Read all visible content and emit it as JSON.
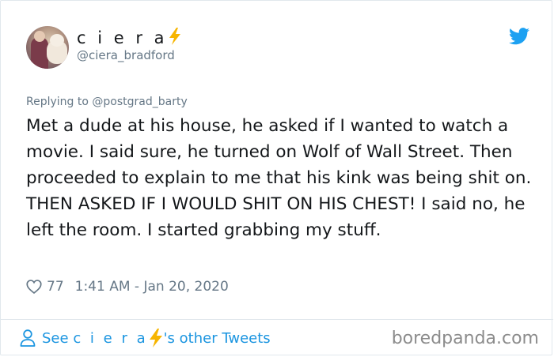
{
  "author": {
    "display_name": "c i e r a",
    "handle": "@ciera_bradford"
  },
  "reply": {
    "prefix": "Replying to",
    "handle": "@postgrad_barty"
  },
  "tweet": {
    "text": "Met a dude at his house, he asked if I wanted to watch a movie. I said sure, he turned on Wolf of Wall Street. Then proceeded to explain to me that his kink was being shit on. THEN ASKED IF I WOULD SHIT ON HIS CHEST! I said no, he left the room. I started grabbing my stuff.",
    "likes": "77",
    "timestamp": "1:41 AM - Jan 20, 2020"
  },
  "footer": {
    "see_prefix": "See",
    "see_name": "c i e r a",
    "see_suffix": "'s other Tweets",
    "watermark": "boredpanda.com"
  },
  "colors": {
    "link": "#1b95e0",
    "muted": "#657786",
    "text": "#14171a",
    "bolt": "#f7b500",
    "twitter_blue": "#1da1f2"
  },
  "icons": [
    "lightning-bolt-icon",
    "twitter-bird-icon",
    "heart-icon",
    "person-icon"
  ]
}
